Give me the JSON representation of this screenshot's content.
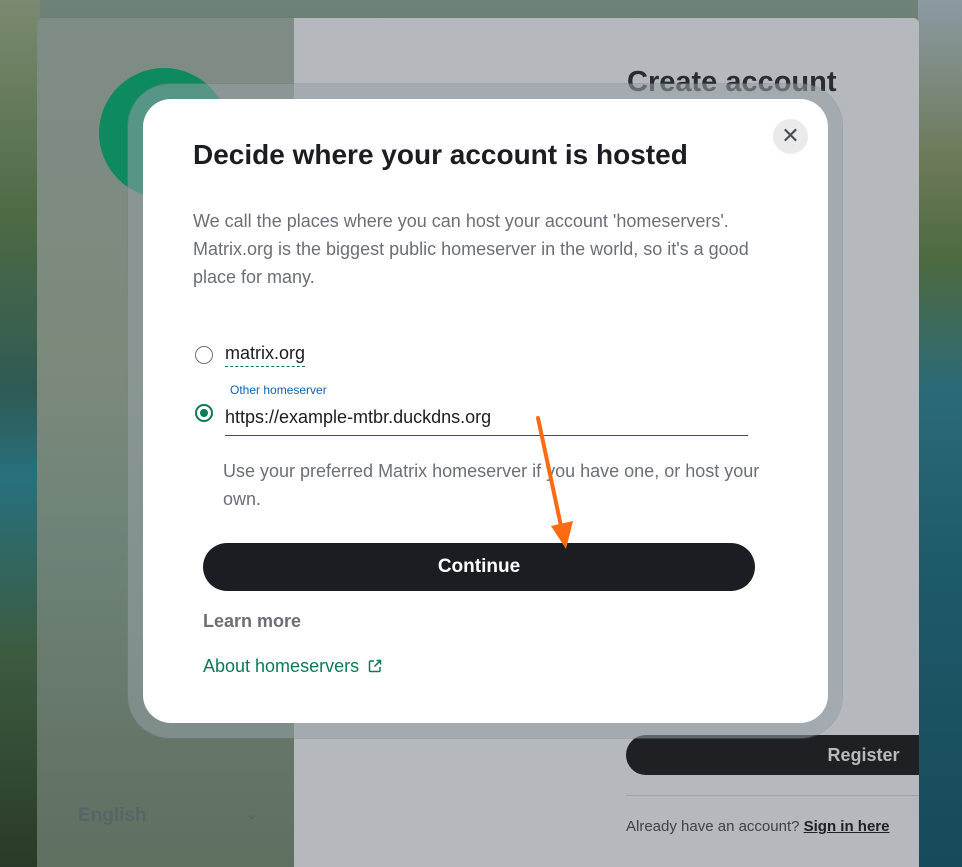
{
  "background": {
    "app_title": "Create account",
    "register_label": "Register",
    "already_text": "Already have an account?",
    "sign_in_label": "Sign in here",
    "language": "English"
  },
  "dialog": {
    "title": "Decide where your account is hosted",
    "description": "We call the places where you can host your account 'homeservers'. Matrix.org is the biggest public homeserver in the world, so it's a good place for many.",
    "option_matrix": "matrix.org",
    "other_label": "Other homeserver",
    "homeserver_value": "https://example-mtbr.duckdns.org",
    "help_text": "Use your preferred Matrix homeserver if you have one, or host your own.",
    "continue_label": "Continue",
    "learn_more_heading": "Learn more",
    "about_link": "About homeservers",
    "close_glyph": "✕"
  },
  "colors": {
    "accent": "#0d7a55",
    "arrow": "#ff6a13"
  }
}
